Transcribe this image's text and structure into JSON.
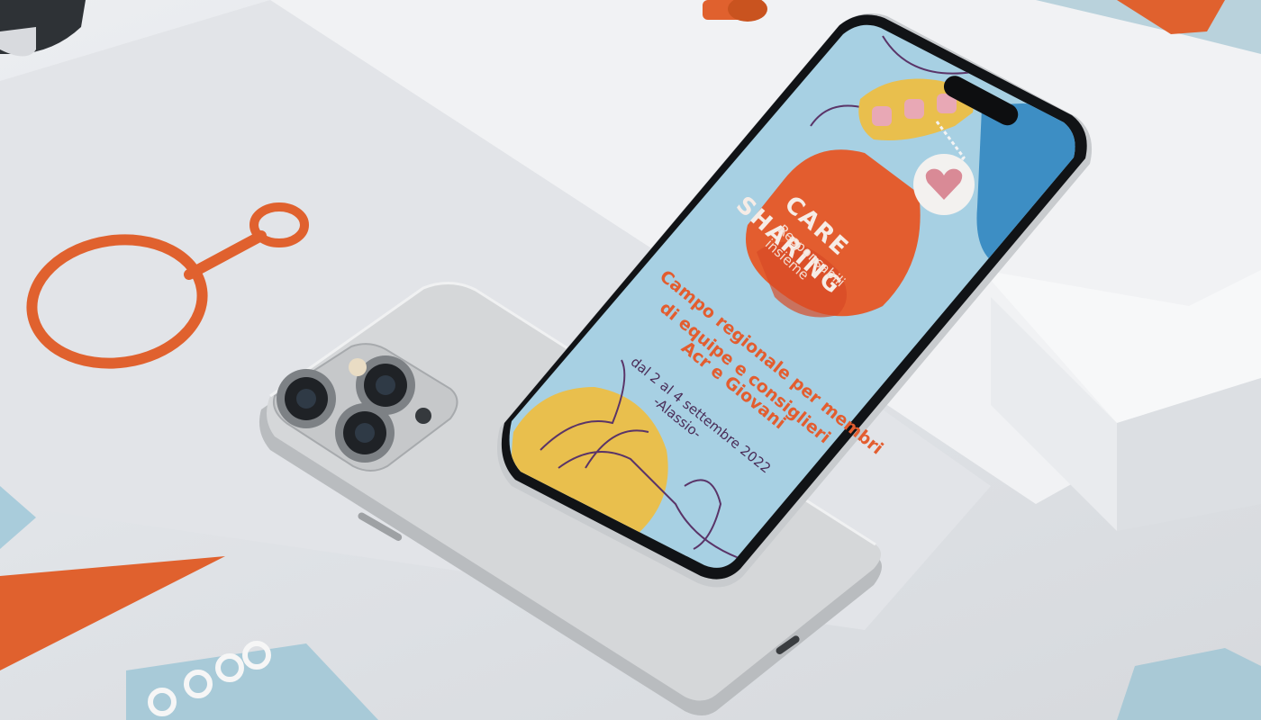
{
  "poster": {
    "title_line1": "CARE",
    "title_line2": "SHARING",
    "subtitle_line1": "Responsabili",
    "subtitle_line2": "insieme",
    "heading_line1": "Campo regionale per membri",
    "heading_line2": "di equipe e consiglieri",
    "heading_line3": "Acr e Giovani",
    "dates": "dal 2 al 4 settembre 2022",
    "place": "-Alassio-"
  },
  "colors": {
    "background": "#e4e6ea",
    "screen": "#a7d0e3",
    "accent_orange": "#e35d2f",
    "yellow": "#e9bf4d",
    "purple": "#4a2d58"
  }
}
